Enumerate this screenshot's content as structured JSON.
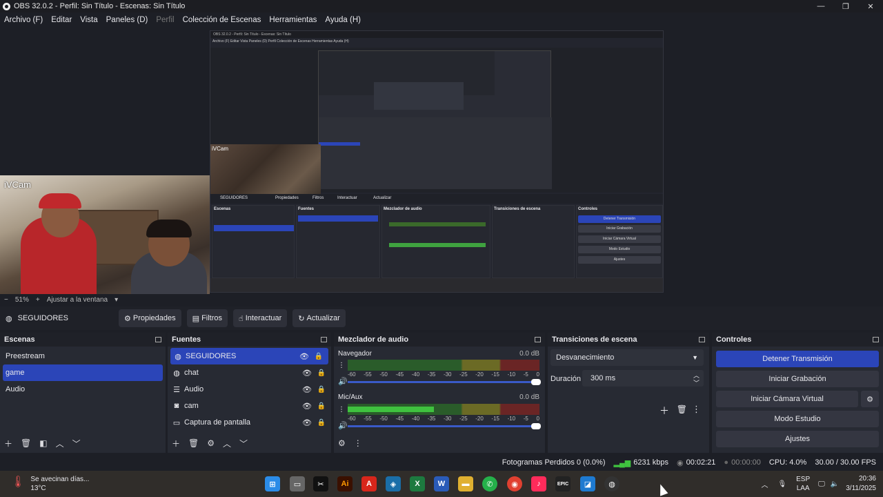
{
  "window": {
    "title": "OBS 32.0.2 - Perfil: Sin Título - Escenas: Sin Título",
    "minimize": "—",
    "maximize": "❐",
    "close": "✕"
  },
  "menu": [
    "Archivo (F)",
    "Editar",
    "Vista",
    "Paneles (D)",
    "Perfil",
    "Colección de Escenas",
    "Herramientas",
    "Ayuda (H)"
  ],
  "preview": {
    "camera_label": "iVCam",
    "nested_title": "OBS 32.0.2 - Perfil: Sin Título - Escenas: Sin Título",
    "nested_menu": "Archivo (F)   Editar   Vista   Paneles (D)   Perfil   Colección de Escenas   Herramientas   Ayuda (H)",
    "nested_camera_label": "iVCam",
    "nested_source": "SEGUIDORES",
    "nested_buttons": [
      "Propiedades",
      "Filtros",
      "Interactuar",
      "Actualizar"
    ],
    "nested_docks": [
      "Escenas",
      "Fuentes",
      "Mezclador de audio",
      "Transiciones de escena",
      "Controles"
    ],
    "nested_controls": [
      "Detener Transmisión",
      "Iniciar Grabación",
      "Iniciar Cámara Virtual",
      "Modo Estudio",
      "Ajustes"
    ]
  },
  "zoom": {
    "minus": "−",
    "value": "51%",
    "plus": "+",
    "fit": "Ajustar a la ventana"
  },
  "source_toolbar": {
    "source_name": "SEGUIDORES",
    "properties": "Propiedades",
    "filters": "Filtros",
    "interact": "Interactuar",
    "refresh": "Actualizar"
  },
  "scenes": {
    "title": "Escenas",
    "items": [
      "Preestream",
      "game",
      "Audio"
    ],
    "selected_index": 1
  },
  "sources": {
    "title": "Fuentes",
    "items": [
      {
        "name": "SEGUIDORES",
        "icon": "browser-icon"
      },
      {
        "name": "chat",
        "icon": "browser-icon"
      },
      {
        "name": "Audio",
        "icon": "list-icon"
      },
      {
        "name": "cam",
        "icon": "camera-icon"
      },
      {
        "name": "Captura de pantalla",
        "icon": "monitor-icon"
      }
    ],
    "selected_index": 0
  },
  "mixer": {
    "title": "Mezclador de audio",
    "scale": [
      "-60",
      "-55",
      "-50",
      "-45",
      "-40",
      "-35",
      "-30",
      "-25",
      "-20",
      "-15",
      "-10",
      "-5",
      "0"
    ],
    "channels": [
      {
        "name": "Navegador",
        "db": "0.0 dB",
        "level": 0.0
      },
      {
        "name": "Mic/Aux",
        "db": "0.0 dB",
        "level": 0.45
      }
    ]
  },
  "transitions": {
    "title": "Transiciones de escena",
    "selected": "Desvanecimiento",
    "duration_label": "Duración",
    "duration_value": "300 ms"
  },
  "controls": {
    "title": "Controles",
    "stop_stream": "Detener Transmisión",
    "start_recording": "Iniciar Grabación",
    "start_virtual_cam": "Iniciar Cámara Virtual",
    "studio_mode": "Modo Estudio",
    "settings": "Ajustes"
  },
  "status": {
    "dropped_frames": "Fotogramas Perdidos 0 (0.0%)",
    "bitrate": "6231 kbps",
    "stream_time": "00:02:21",
    "record_time": "00:00:00",
    "cpu": "CPU: 4.0%",
    "fps": "30.00 / 30.00 FPS"
  },
  "taskbar": {
    "weather_line1": "Se avecinan días...",
    "weather_line2": "13°C",
    "apps": [
      "windows-start-icon",
      "file-manager-icon",
      "capcut-icon",
      "illustrator-icon",
      "acrobat-icon",
      "vpn-icon",
      "excel-icon",
      "word-icon",
      "folder-icon",
      "whatsapp-icon",
      "chrome-icon",
      "tiktok-icon",
      "epic-games-icon",
      "bluestacks-icon",
      "obs-icon"
    ],
    "lang1": "ESP",
    "lang2": "LAA",
    "time": "20:36",
    "date": "3/11/2025"
  },
  "colors": {
    "accent": "#2b45b8",
    "background": "#1d1f26",
    "dock": "#272a33"
  }
}
